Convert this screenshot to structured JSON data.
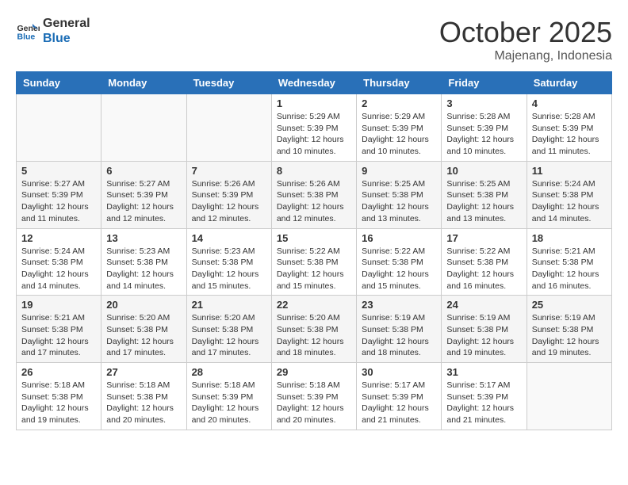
{
  "header": {
    "logo_line1": "General",
    "logo_line2": "Blue",
    "month": "October 2025",
    "location": "Majenang, Indonesia"
  },
  "weekdays": [
    "Sunday",
    "Monday",
    "Tuesday",
    "Wednesday",
    "Thursday",
    "Friday",
    "Saturday"
  ],
  "weeks": [
    [
      {
        "day": "",
        "info": ""
      },
      {
        "day": "",
        "info": ""
      },
      {
        "day": "",
        "info": ""
      },
      {
        "day": "1",
        "info": "Sunrise: 5:29 AM\nSunset: 5:39 PM\nDaylight: 12 hours\nand 10 minutes."
      },
      {
        "day": "2",
        "info": "Sunrise: 5:29 AM\nSunset: 5:39 PM\nDaylight: 12 hours\nand 10 minutes."
      },
      {
        "day": "3",
        "info": "Sunrise: 5:28 AM\nSunset: 5:39 PM\nDaylight: 12 hours\nand 10 minutes."
      },
      {
        "day": "4",
        "info": "Sunrise: 5:28 AM\nSunset: 5:39 PM\nDaylight: 12 hours\nand 11 minutes."
      }
    ],
    [
      {
        "day": "5",
        "info": "Sunrise: 5:27 AM\nSunset: 5:39 PM\nDaylight: 12 hours\nand 11 minutes."
      },
      {
        "day": "6",
        "info": "Sunrise: 5:27 AM\nSunset: 5:39 PM\nDaylight: 12 hours\nand 12 minutes."
      },
      {
        "day": "7",
        "info": "Sunrise: 5:26 AM\nSunset: 5:39 PM\nDaylight: 12 hours\nand 12 minutes."
      },
      {
        "day": "8",
        "info": "Sunrise: 5:26 AM\nSunset: 5:38 PM\nDaylight: 12 hours\nand 12 minutes."
      },
      {
        "day": "9",
        "info": "Sunrise: 5:25 AM\nSunset: 5:38 PM\nDaylight: 12 hours\nand 13 minutes."
      },
      {
        "day": "10",
        "info": "Sunrise: 5:25 AM\nSunset: 5:38 PM\nDaylight: 12 hours\nand 13 minutes."
      },
      {
        "day": "11",
        "info": "Sunrise: 5:24 AM\nSunset: 5:38 PM\nDaylight: 12 hours\nand 14 minutes."
      }
    ],
    [
      {
        "day": "12",
        "info": "Sunrise: 5:24 AM\nSunset: 5:38 PM\nDaylight: 12 hours\nand 14 minutes."
      },
      {
        "day": "13",
        "info": "Sunrise: 5:23 AM\nSunset: 5:38 PM\nDaylight: 12 hours\nand 14 minutes."
      },
      {
        "day": "14",
        "info": "Sunrise: 5:23 AM\nSunset: 5:38 PM\nDaylight: 12 hours\nand 15 minutes."
      },
      {
        "day": "15",
        "info": "Sunrise: 5:22 AM\nSunset: 5:38 PM\nDaylight: 12 hours\nand 15 minutes."
      },
      {
        "day": "16",
        "info": "Sunrise: 5:22 AM\nSunset: 5:38 PM\nDaylight: 12 hours\nand 15 minutes."
      },
      {
        "day": "17",
        "info": "Sunrise: 5:22 AM\nSunset: 5:38 PM\nDaylight: 12 hours\nand 16 minutes."
      },
      {
        "day": "18",
        "info": "Sunrise: 5:21 AM\nSunset: 5:38 PM\nDaylight: 12 hours\nand 16 minutes."
      }
    ],
    [
      {
        "day": "19",
        "info": "Sunrise: 5:21 AM\nSunset: 5:38 PM\nDaylight: 12 hours\nand 17 minutes."
      },
      {
        "day": "20",
        "info": "Sunrise: 5:20 AM\nSunset: 5:38 PM\nDaylight: 12 hours\nand 17 minutes."
      },
      {
        "day": "21",
        "info": "Sunrise: 5:20 AM\nSunset: 5:38 PM\nDaylight: 12 hours\nand 17 minutes."
      },
      {
        "day": "22",
        "info": "Sunrise: 5:20 AM\nSunset: 5:38 PM\nDaylight: 12 hours\nand 18 minutes."
      },
      {
        "day": "23",
        "info": "Sunrise: 5:19 AM\nSunset: 5:38 PM\nDaylight: 12 hours\nand 18 minutes."
      },
      {
        "day": "24",
        "info": "Sunrise: 5:19 AM\nSunset: 5:38 PM\nDaylight: 12 hours\nand 19 minutes."
      },
      {
        "day": "25",
        "info": "Sunrise: 5:19 AM\nSunset: 5:38 PM\nDaylight: 12 hours\nand 19 minutes."
      }
    ],
    [
      {
        "day": "26",
        "info": "Sunrise: 5:18 AM\nSunset: 5:38 PM\nDaylight: 12 hours\nand 19 minutes."
      },
      {
        "day": "27",
        "info": "Sunrise: 5:18 AM\nSunset: 5:38 PM\nDaylight: 12 hours\nand 20 minutes."
      },
      {
        "day": "28",
        "info": "Sunrise: 5:18 AM\nSunset: 5:39 PM\nDaylight: 12 hours\nand 20 minutes."
      },
      {
        "day": "29",
        "info": "Sunrise: 5:18 AM\nSunset: 5:39 PM\nDaylight: 12 hours\nand 20 minutes."
      },
      {
        "day": "30",
        "info": "Sunrise: 5:17 AM\nSunset: 5:39 PM\nDaylight: 12 hours\nand 21 minutes."
      },
      {
        "day": "31",
        "info": "Sunrise: 5:17 AM\nSunset: 5:39 PM\nDaylight: 12 hours\nand 21 minutes."
      },
      {
        "day": "",
        "info": ""
      }
    ]
  ]
}
